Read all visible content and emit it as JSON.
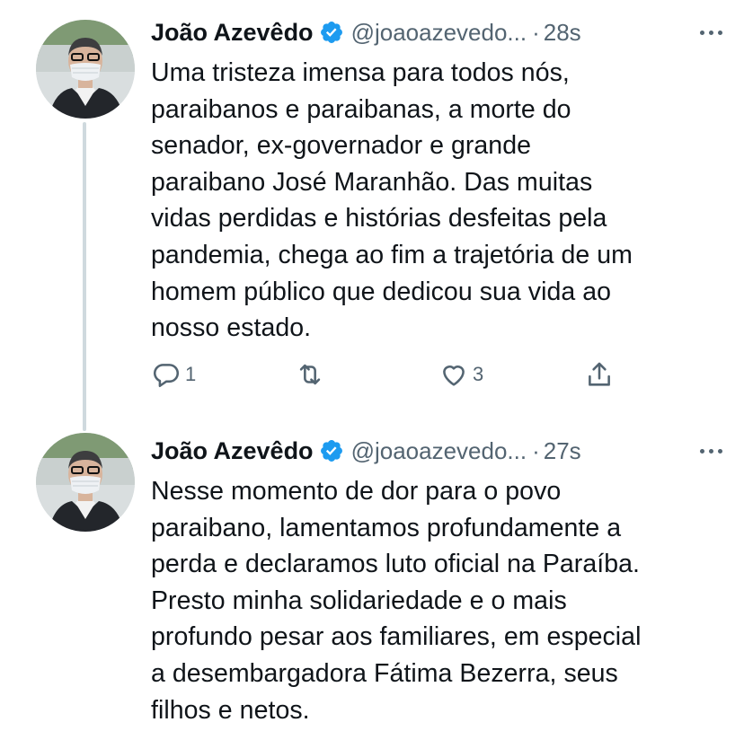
{
  "tweets": [
    {
      "author_name": "João Azevêdo",
      "handle": "@joaoazevedo...",
      "dot": "·",
      "time": "28s",
      "text": "Uma tristeza imensa para todos nós,\nparaibanos e paraibanas, a morte do\nsenador, ex-governador e grande\nparaibano José Maranhão. Das muitas\nvidas perdidas e histórias desfeitas pela\npandemia, chega ao fim a trajetória de um\nhomem público que dedicou sua vida ao\nnosso estado.",
      "reply_count": "1",
      "retweet_count": "",
      "like_count": "3"
    },
    {
      "author_name": "João Azevêdo",
      "handle": "@joaoazevedo...",
      "dot": "·",
      "time": "27s",
      "text": "Nesse momento de dor para o povo\nparaibano, lamentamos profundamente a\nperda e declaramos luto oficial na Paraíba.\nPresto minha solidariedade e o mais\nprofundo pesar aos familiares, em especial\na desembargadora Fátima Bezerra, seus\nfilhos e netos."
    }
  ],
  "icons": {
    "verified": "verified-badge-icon",
    "more": "more-options-icon",
    "reply": "reply-icon",
    "retweet": "retweet-icon",
    "like": "like-icon",
    "share": "share-icon"
  },
  "colors": {
    "text": "#0f1419",
    "secondary": "#536471",
    "verified_blue": "#1d9bf0",
    "thread_line": "#cfd9de"
  }
}
